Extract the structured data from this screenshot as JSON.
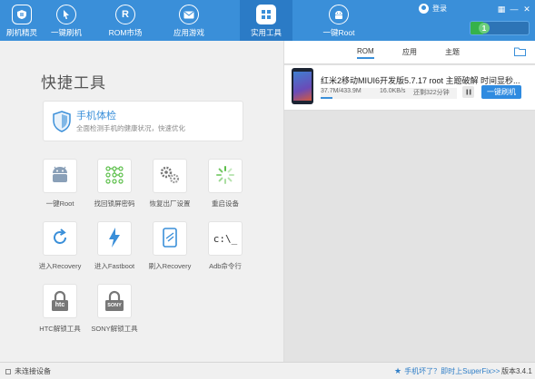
{
  "topnav": {
    "items": [
      {
        "label": "刷机精灵",
        "icon": "shield-s-icon"
      },
      {
        "label": "一键刷机",
        "icon": "cursor-icon"
      },
      {
        "label": "ROM市场",
        "icon": "r-icon"
      },
      {
        "label": "应用游戏",
        "icon": "mail-icon"
      },
      {
        "label": "实用工具",
        "icon": "grid-icon"
      },
      {
        "label": "一键Root",
        "icon": "android-icon"
      }
    ],
    "active_index": 4
  },
  "header": {
    "login_label": "登录",
    "status_number": "1",
    "win_controls": [
      "▦",
      "—",
      "✕"
    ]
  },
  "tools_panel": {
    "title": "快捷工具",
    "health": {
      "title": "手机体检",
      "desc": "全面检测手机的健康状况，快速优化"
    },
    "tools": [
      {
        "label": "一键Root",
        "icon": "android-icon"
      },
      {
        "label": "找回锁屏密码",
        "icon": "pattern-lock-icon"
      },
      {
        "label": "恢复出厂设置",
        "icon": "gears-icon"
      },
      {
        "label": "重启设备",
        "icon": "loading-icon"
      },
      {
        "label": "进入Recovery",
        "icon": "refresh-icon"
      },
      {
        "label": "进入Fastboot",
        "icon": "lightning-icon"
      },
      {
        "label": "刷入Recovery",
        "icon": "tablet-icon"
      },
      {
        "label": "Adb命令行",
        "icon": "terminal-icon"
      },
      {
        "label": "HTC解锁工具",
        "icon": "htc-lock-icon",
        "brand": "htc"
      },
      {
        "label": "SONY解锁工具",
        "icon": "sony-lock-icon",
        "brand": "SONY"
      }
    ]
  },
  "download_panel": {
    "tabs": [
      "ROM",
      "应用",
      "主题"
    ],
    "active_tab": 0,
    "item": {
      "title": "红米2移动MIUI6开发版5.7.17 root 主题破解 时间显秒...",
      "size": "37.7M/433.9M",
      "speed": "16.0KB/s",
      "remaining": "还剩322分钟",
      "progress": 0.087,
      "action_label": "一键刷机"
    }
  },
  "statusbar": {
    "device_state": "未连接设备",
    "superfix": "手机坏了？即时上SuperFix>>",
    "version": "版本3.4.1"
  },
  "colors": {
    "accent": "#3a8fd9",
    "active_nav": "#2b7bc6",
    "status_green": "#36b24b"
  }
}
